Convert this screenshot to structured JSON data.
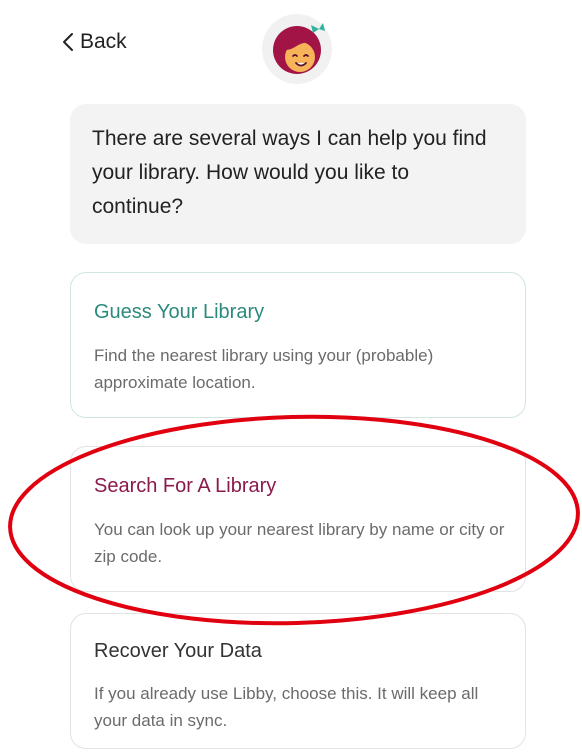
{
  "header": {
    "back_label": "Back"
  },
  "bubble": {
    "text": "There are several ways I can help you find your library. How would you like to continue?"
  },
  "options": [
    {
      "title": "Guess Your Library",
      "description": "Find the nearest library using your (probable) approximate location."
    },
    {
      "title": "Search For A Library",
      "description": "You can look up your nearest library by name or city or zip code."
    },
    {
      "title": "Recover Your Data",
      "description": "If you already use Libby, choose this. It will keep all your data in sync."
    }
  ],
  "colors": {
    "guess_title": "#2c8a7d",
    "search_title": "#8a1a4c",
    "recover_title": "#333333",
    "annotation": "#e0000f",
    "avatar_hair": "#a21446",
    "avatar_face": "#f7b35a"
  }
}
